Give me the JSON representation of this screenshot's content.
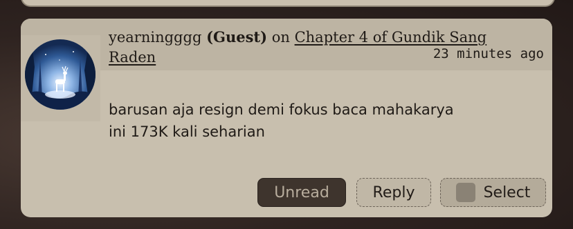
{
  "comment": {
    "author": "yearningggg",
    "role": "(Guest)",
    "connector": "on",
    "chapter_link": "Chapter 4 of Gundik Sang Raden",
    "timestamp": "23 minutes ago",
    "body_line1": "barusan aja resign demi fokus baca mahakarya",
    "body_line2": "ini 173K kali seharian",
    "avatar_icon": "deer-forest-avatar-icon"
  },
  "actions": {
    "unread_label": "Unread",
    "reply_label": "Reply",
    "select_label": "Select"
  },
  "colors": {
    "card_bg": "#c8bfae",
    "header_band": "#bdb4a3",
    "unread_bg": "#3e342d",
    "page_bg": "#2e2320"
  }
}
